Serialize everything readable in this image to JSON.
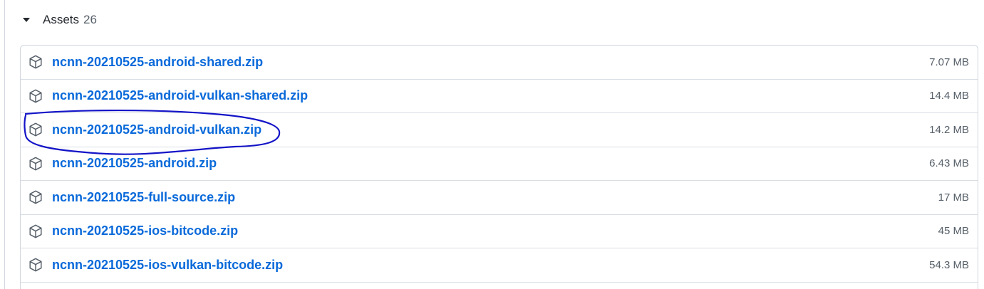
{
  "header": {
    "title": "Assets",
    "count": "26"
  },
  "assets": [
    {
      "name": "ncnn-20210525-android-shared.zip",
      "size": "7.07 MB",
      "icon": "package-icon"
    },
    {
      "name": "ncnn-20210525-android-vulkan-shared.zip",
      "size": "14.4 MB",
      "icon": "package-icon"
    },
    {
      "name": "ncnn-20210525-android-vulkan.zip",
      "size": "14.2 MB",
      "icon": "package-icon"
    },
    {
      "name": "ncnn-20210525-android.zip",
      "size": "6.43 MB",
      "icon": "package-icon"
    },
    {
      "name": "ncnn-20210525-full-source.zip",
      "size": "17 MB",
      "icon": "package-icon"
    },
    {
      "name": "ncnn-20210525-ios-bitcode.zip",
      "size": "45 MB",
      "icon": "package-icon"
    },
    {
      "name": "ncnn-20210525-ios-vulkan-bitcode.zip",
      "size": "54.3 MB",
      "icon": "package-icon"
    }
  ],
  "colors": {
    "link": "#0969da",
    "annotation_ink": "#1010d0"
  }
}
